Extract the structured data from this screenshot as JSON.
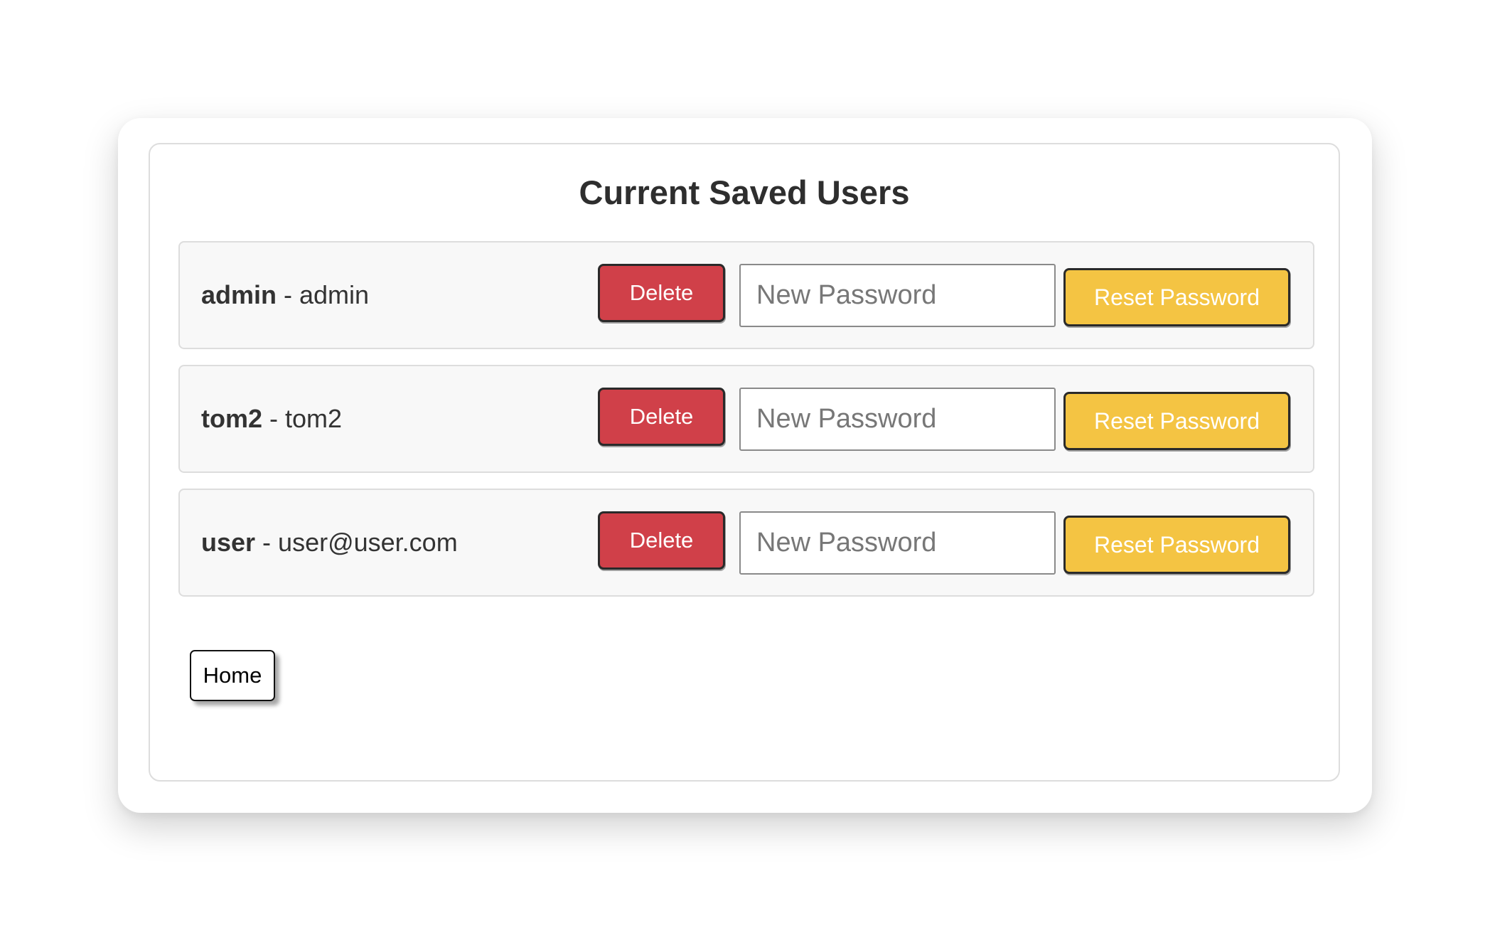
{
  "page": {
    "title": "Current Saved Users"
  },
  "users": [
    {
      "name": "admin",
      "separator": " - ",
      "email": "admin",
      "delete_label": "Delete",
      "password_placeholder": "New Password",
      "reset_label": "Reset Password"
    },
    {
      "name": "tom2",
      "separator": " - ",
      "email": "tom2",
      "delete_label": "Delete",
      "password_placeholder": "New Password",
      "reset_label": "Reset Password"
    },
    {
      "name": "user",
      "separator": " - ",
      "email": "user@user.com",
      "delete_label": "Delete",
      "password_placeholder": "New Password",
      "reset_label": "Reset Password"
    }
  ],
  "nav": {
    "home_label": "Home"
  },
  "colors": {
    "delete": "#d04049",
    "reset": "#f4c443",
    "row_background": "#f8f8f8"
  }
}
